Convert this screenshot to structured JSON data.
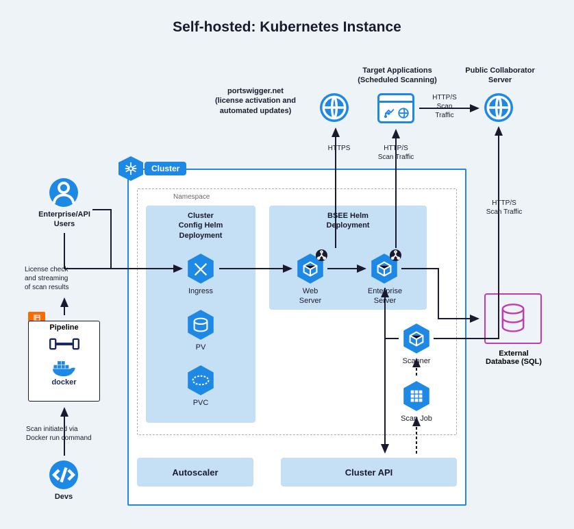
{
  "title": "Self-hosted: Kubernetes Instance",
  "top": {
    "portswigger": "portswigger.net\n(license activation and\nautomated updates)",
    "target_apps": "Target Applications\n(Scheduled Scanning)",
    "collaborator": "Public Collaborator\nServer"
  },
  "left": {
    "users": "Enterprise/API\nUsers",
    "license_check": "License check\nand streaming\nof scan results",
    "pipeline": "Pipeline",
    "docker": "docker",
    "scan_init": "Scan initiated via\nDocker run command",
    "devs": "Devs"
  },
  "cluster": {
    "label": "Cluster",
    "namespace": "Namespace",
    "cfg_title": "Cluster\nConfig Helm\nDeployment",
    "bsee_title": "BSEE Helm\nDeployment",
    "ingress": "Ingress",
    "pv": "PV",
    "pvc": "PVC",
    "web_server": "Web\nServer",
    "ent_server": "Enterprise\nServer",
    "scanner": "Scanner",
    "scan_job": "Scan Job",
    "autoscaler": "Autoscaler",
    "cluster_api": "Cluster API"
  },
  "edges": {
    "https": "HTTPS",
    "http_s_scan": "HTTP/S\nScan Traffic",
    "http_s_scan2": "HTTP/S\nScan\nTraffic"
  },
  "right": {
    "ext_db": "External\nDatabase (SQL)"
  }
}
